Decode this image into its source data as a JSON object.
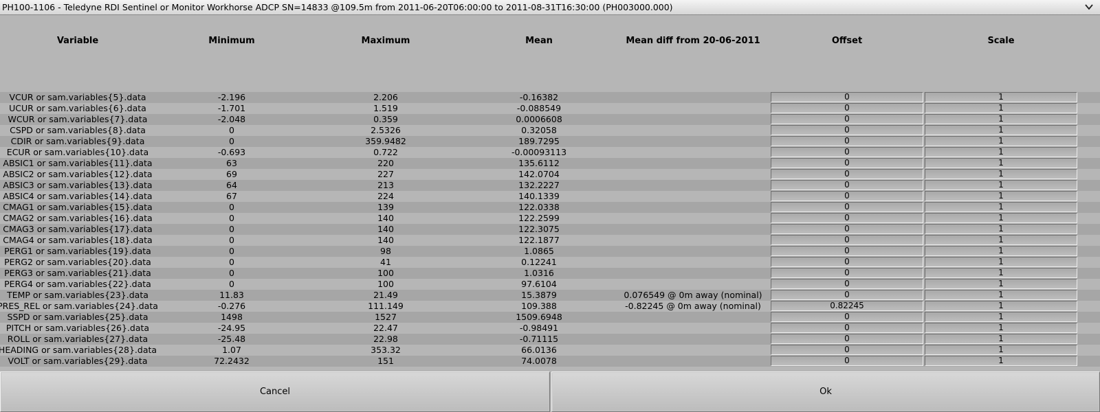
{
  "window": {
    "title": "PH100-1106 - Teledyne RDI Sentinel or Monitor Workhorse ADCP SN=14833 @109.5m from 2011-06-20T06:00:00 to 2011-08-31T16:30:00 (PH003000.000)"
  },
  "table": {
    "headers": [
      "Variable",
      "Minimum",
      "Maximum",
      "Mean",
      "Mean diff from 20-06-2011",
      "Offset",
      "Scale"
    ],
    "rows": [
      {
        "variable": "VCUR or sam.variables{5}.data",
        "min": "-2.196",
        "max": "2.206",
        "mean": "-0.16382",
        "diff": "",
        "offset": "0",
        "scale": "1"
      },
      {
        "variable": "UCUR or sam.variables{6}.data",
        "min": "-1.701",
        "max": "1.519",
        "mean": "-0.088549",
        "diff": "",
        "offset": "0",
        "scale": "1"
      },
      {
        "variable": "WCUR or sam.variables{7}.data",
        "min": "-2.048",
        "max": "0.359",
        "mean": "0.0006608",
        "diff": "",
        "offset": "0",
        "scale": "1"
      },
      {
        "variable": "CSPD or sam.variables{8}.data",
        "min": "0",
        "max": "2.5326",
        "mean": "0.32058",
        "diff": "",
        "offset": "0",
        "scale": "1"
      },
      {
        "variable": "CDIR or sam.variables{9}.data",
        "min": "0",
        "max": "359.9482",
        "mean": "189.7295",
        "diff": "",
        "offset": "0",
        "scale": "1"
      },
      {
        "variable": "ECUR or sam.variables{10}.data",
        "min": "-0.693",
        "max": "0.722",
        "mean": "-0.00093113",
        "diff": "",
        "offset": "0",
        "scale": "1"
      },
      {
        "variable": "ABSIC1 or sam.variables{11}.data",
        "min": "63",
        "max": "220",
        "mean": "135.6112",
        "diff": "",
        "offset": "0",
        "scale": "1"
      },
      {
        "variable": "ABSIC2 or sam.variables{12}.data",
        "min": "69",
        "max": "227",
        "mean": "142.0704",
        "diff": "",
        "offset": "0",
        "scale": "1"
      },
      {
        "variable": "ABSIC3 or sam.variables{13}.data",
        "min": "64",
        "max": "213",
        "mean": "132.2227",
        "diff": "",
        "offset": "0",
        "scale": "1"
      },
      {
        "variable": "ABSIC4 or sam.variables{14}.data",
        "min": "67",
        "max": "224",
        "mean": "140.1339",
        "diff": "",
        "offset": "0",
        "scale": "1"
      },
      {
        "variable": "CMAG1 or sam.variables{15}.data",
        "min": "0",
        "max": "139",
        "mean": "122.0338",
        "diff": "",
        "offset": "0",
        "scale": "1"
      },
      {
        "variable": "CMAG2 or sam.variables{16}.data",
        "min": "0",
        "max": "140",
        "mean": "122.2599",
        "diff": "",
        "offset": "0",
        "scale": "1"
      },
      {
        "variable": "CMAG3 or sam.variables{17}.data",
        "min": "0",
        "max": "140",
        "mean": "122.3075",
        "diff": "",
        "offset": "0",
        "scale": "1"
      },
      {
        "variable": "CMAG4 or sam.variables{18}.data",
        "min": "0",
        "max": "140",
        "mean": "122.1877",
        "diff": "",
        "offset": "0",
        "scale": "1"
      },
      {
        "variable": "PERG1 or sam.variables{19}.data",
        "min": "0",
        "max": "98",
        "mean": "1.0865",
        "diff": "",
        "offset": "0",
        "scale": "1"
      },
      {
        "variable": "PERG2 or sam.variables{20}.data",
        "min": "0",
        "max": "41",
        "mean": "0.12241",
        "diff": "",
        "offset": "0",
        "scale": "1"
      },
      {
        "variable": "PERG3 or sam.variables{21}.data",
        "min": "0",
        "max": "100",
        "mean": "1.0316",
        "diff": "",
        "offset": "0",
        "scale": "1"
      },
      {
        "variable": "PERG4 or sam.variables{22}.data",
        "min": "0",
        "max": "100",
        "mean": "97.6104",
        "diff": "",
        "offset": "0",
        "scale": "1"
      },
      {
        "variable": "TEMP or sam.variables{23}.data",
        "min": "11.83",
        "max": "21.49",
        "mean": "15.3879",
        "diff": "0.076549 @ 0m away (nominal)",
        "offset": "0",
        "scale": "1"
      },
      {
        "variable": "PRES_REL or sam.variables{24}.data",
        "min": "-0.276",
        "max": "111.149",
        "mean": "109.388",
        "diff": "-0.82245 @ 0m away (nominal)",
        "offset": "0.82245",
        "scale": "1"
      },
      {
        "variable": "SSPD or sam.variables{25}.data",
        "min": "1498",
        "max": "1527",
        "mean": "1509.6948",
        "diff": "",
        "offset": "0",
        "scale": "1"
      },
      {
        "variable": "PITCH or sam.variables{26}.data",
        "min": "-24.95",
        "max": "22.47",
        "mean": "-0.98491",
        "diff": "",
        "offset": "0",
        "scale": "1"
      },
      {
        "variable": "ROLL or sam.variables{27}.data",
        "min": "-25.48",
        "max": "22.98",
        "mean": "-0.71115",
        "diff": "",
        "offset": "0",
        "scale": "1"
      },
      {
        "variable": "HEADING or sam.variables{28}.data",
        "min": "1.07",
        "max": "353.32",
        "mean": "66.0136",
        "diff": "",
        "offset": "0",
        "scale": "1"
      },
      {
        "variable": "VOLT or sam.variables{29}.data",
        "min": "72.2432",
        "max": "151",
        "mean": "74.0078",
        "diff": "",
        "offset": "0",
        "scale": "1"
      }
    ]
  },
  "buttons": {
    "cancel": "Cancel",
    "ok": "Ok"
  }
}
